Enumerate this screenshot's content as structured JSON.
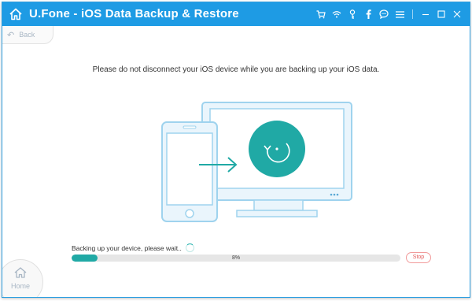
{
  "window": {
    "title": "U.Fone - iOS Data Backup & Restore"
  },
  "titlebar_icons": [
    "cart-icon",
    "wifi-icon",
    "key-icon",
    "facebook-icon",
    "chat-icon",
    "menu-icon",
    "minimize-icon",
    "maximize-icon",
    "close-icon"
  ],
  "toolbar": {
    "back_label": "Back"
  },
  "main": {
    "message": "Please do not disconnect your iOS device while you are backing up your iOS data."
  },
  "progress": {
    "status_text": "Backing up your device, please wait..",
    "percent_text": "8%",
    "value_fraction": 0.08,
    "stop_label": "Stop"
  },
  "nav": {
    "home_label": "Home"
  },
  "colors": {
    "titlebar": "#1e9be4",
    "accent": "#20a9a5",
    "device_outline": "#9fd3ee",
    "device_fill": "#eaf5fc",
    "stop": "#e25b5b"
  }
}
